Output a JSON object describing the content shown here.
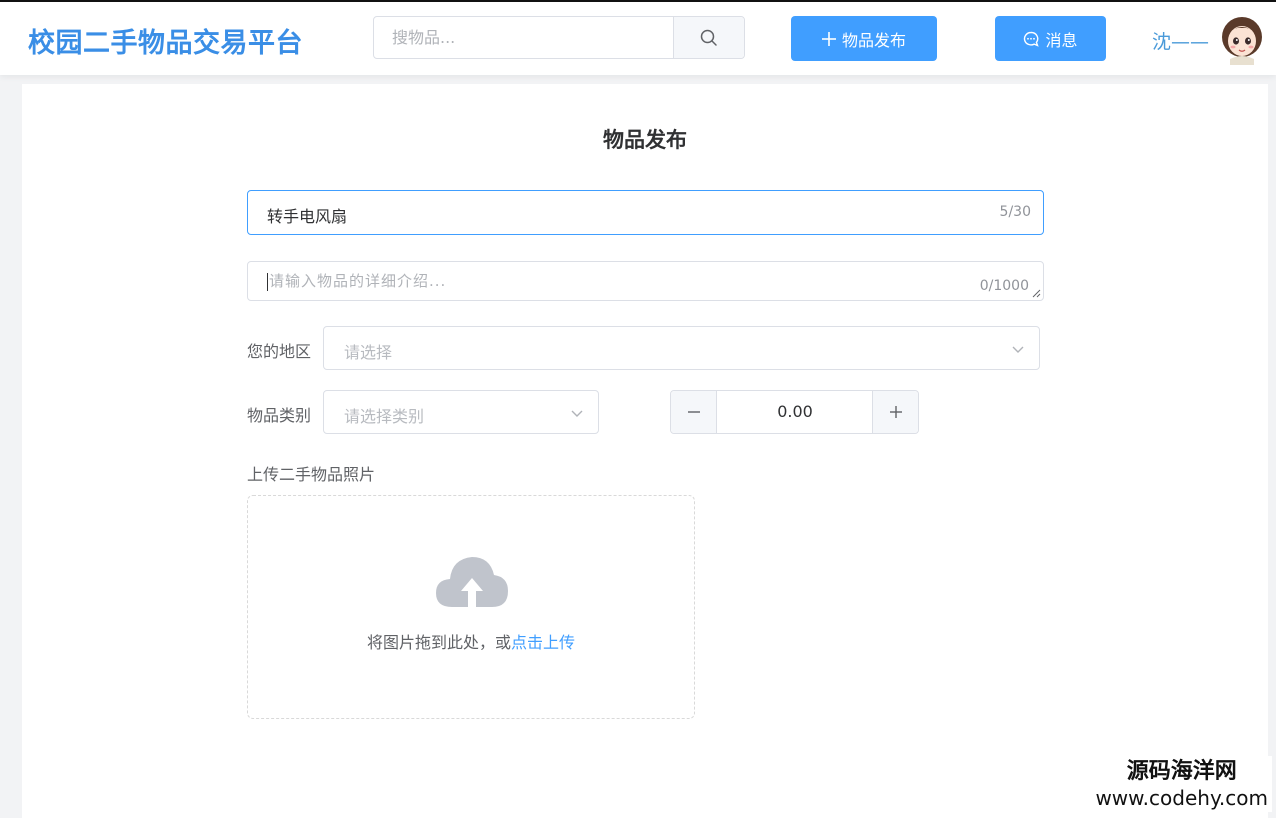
{
  "header": {
    "logo": "校园二手物品交易平台",
    "search_placeholder": "搜物品...",
    "publish_label": "物品发布",
    "message_label": "消息",
    "username": "沈——"
  },
  "form": {
    "page_title": "物品发布",
    "title_value": "转手电风扇",
    "title_counter": "5/30",
    "desc_placeholder": "请输入物品的详细介绍...",
    "desc_counter": "0/1000",
    "region_label": "您的地区",
    "region_placeholder": "请选择",
    "category_label": "物品类别",
    "category_placeholder": "请选择类别",
    "price_value": "0.00",
    "upload_label": "上传二手物品照片",
    "upload_hint": "将图片拖到此处，或",
    "upload_link": "点击上传"
  },
  "watermark": {
    "line1": "源码海洋网",
    "line2": "www.codehy.com"
  },
  "colors": {
    "accent": "#409eff",
    "logo": "#3a8ee6",
    "background": "#f2f3f5"
  },
  "icons": {
    "search": "search-icon",
    "publish": "plus-icon",
    "message": "chat-icon",
    "upload": "cloud-upload-icon"
  }
}
